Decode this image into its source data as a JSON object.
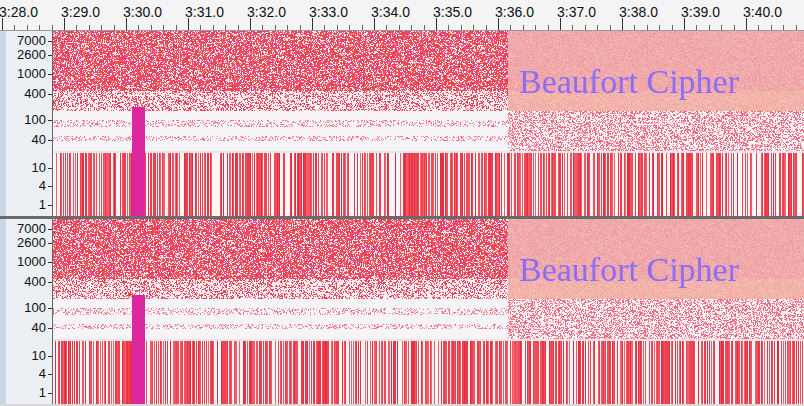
{
  "ruler": {
    "labels": [
      "3:28.0",
      "3:29.0",
      "3:30.0",
      "3:31.0",
      "3:32.0",
      "3:33.0",
      "3:34.0",
      "3:35.0",
      "3:36.0",
      "3:37.0",
      "3:38.0",
      "3:39.0",
      "3:40.0"
    ]
  },
  "tracks": [
    {
      "scale": [
        "7000",
        "2600",
        "1000",
        "400",
        "100",
        "40",
        "10",
        "4",
        "1"
      ],
      "watermark": "Beaufort Cipher"
    },
    {
      "scale": [
        "7000",
        "2600",
        "1000",
        "400",
        "100",
        "40",
        "10",
        "4",
        "1"
      ],
      "watermark": "Beaufort Cipher"
    }
  ]
}
